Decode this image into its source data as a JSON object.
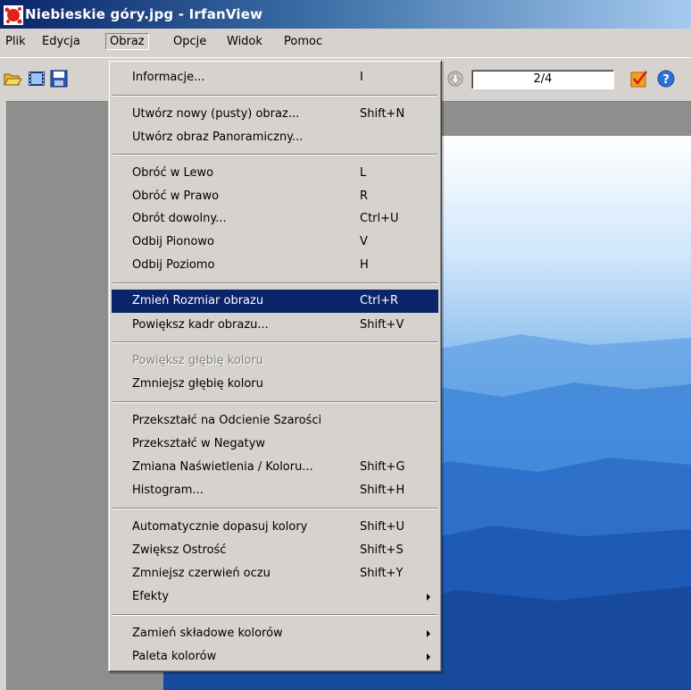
{
  "window": {
    "title": "Niebieskie góry.jpg - IrfanView"
  },
  "menubar": [
    "Plik",
    "Edycja",
    "Obraz",
    "Opcje",
    "Widok",
    "Pomoc"
  ],
  "toolbar": {
    "page_indicator": "2/4"
  },
  "obraz_menu": {
    "informacje": {
      "label": "Informacje...",
      "shortcut": "I"
    },
    "nowy_obraz": {
      "label": "Utwórz nowy (pusty) obraz...",
      "shortcut": "Shift+N"
    },
    "panoramiczny": {
      "label": "Utwórz obraz Panoramiczny...",
      "shortcut": ""
    },
    "obroc_lewo": {
      "label": "Obróć w Lewo",
      "shortcut": "L"
    },
    "obroc_prawo": {
      "label": "Obróć w Prawo",
      "shortcut": "R"
    },
    "obrot_dowolny": {
      "label": "Obrót dowolny...",
      "shortcut": "Ctrl+U"
    },
    "odbij_pionowo": {
      "label": "Odbij Pionowo",
      "shortcut": "V"
    },
    "odbij_poziomo": {
      "label": "Odbij Poziomo",
      "shortcut": "H"
    },
    "zmien_rozmiar": {
      "label": "Zmień Rozmiar obrazu",
      "shortcut": "Ctrl+R"
    },
    "powieksz_kadr": {
      "label": "Powiększ kadr obrazu...",
      "shortcut": "Shift+V"
    },
    "powieksz_glebie": {
      "label": "Powiększ głębię koloru",
      "shortcut": ""
    },
    "zmniejsz_glebie": {
      "label": "Zmniejsz głębię koloru",
      "shortcut": ""
    },
    "odcienie_szarosci": {
      "label": "Przekształć na Odcienie Szarości",
      "shortcut": ""
    },
    "negatyw": {
      "label": "Przekształć w Negatyw",
      "shortcut": ""
    },
    "naswietlenie": {
      "label": "Zmiana Naświetlenia / Koloru...",
      "shortcut": "Shift+G"
    },
    "histogram": {
      "label": "Histogram...",
      "shortcut": "Shift+H"
    },
    "auto_kolory": {
      "label": "Automatycznie dopasuj kolory",
      "shortcut": "Shift+U"
    },
    "ostrosc": {
      "label": "Zwiększ Ostrość",
      "shortcut": "Shift+S"
    },
    "czerwien_oczu": {
      "label": "Zmniejsz czerwień oczu",
      "shortcut": "Shift+Y"
    },
    "efekty": {
      "label": "Efekty",
      "shortcut": ""
    },
    "zamien_skladowe": {
      "label": "Zamień składowe kolorów",
      "shortcut": ""
    },
    "paleta": {
      "label": "Paleta kolorów",
      "shortcut": ""
    }
  },
  "colors": {
    "highlight": "#0a246a",
    "face": "#d6d3ce",
    "title_start": "#0a246a"
  }
}
